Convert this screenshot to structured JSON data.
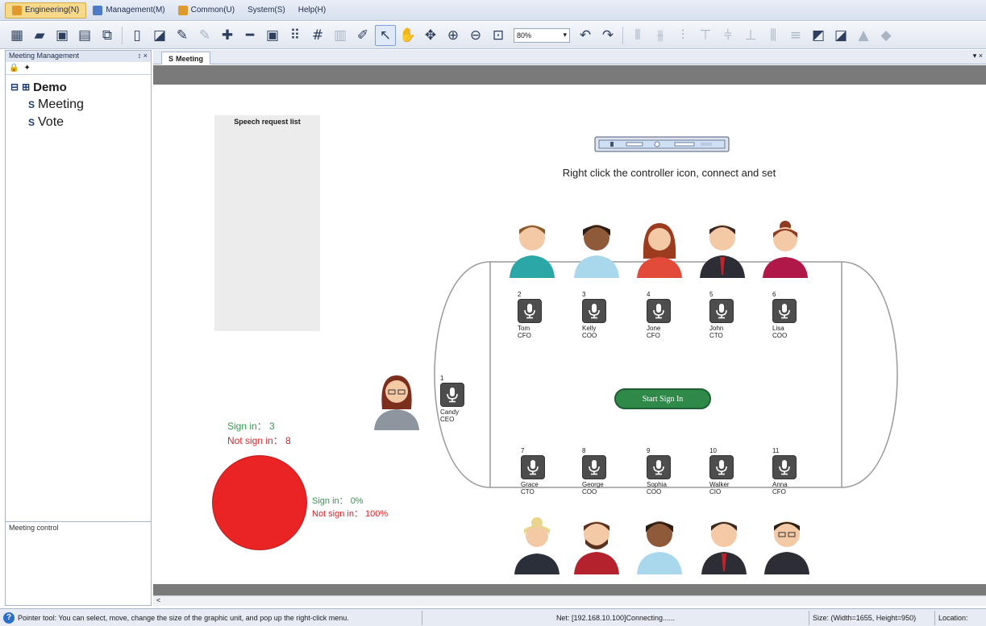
{
  "menu": {
    "items": [
      {
        "label": "Engineering(N)"
      },
      {
        "label": "Management(M)"
      },
      {
        "label": "Common(U)"
      },
      {
        "label": "System(S)"
      },
      {
        "label": "Help(H)"
      }
    ]
  },
  "toolbar": {
    "zoom_value": "80%",
    "zoom_arrow": "▾"
  },
  "left_panel": {
    "title": "Meeting Management",
    "pin": "↕ ×",
    "tree": {
      "root": "Demo",
      "children": [
        "Meeting",
        "Vote"
      ]
    },
    "meeting_control_title": "Meeting control"
  },
  "document": {
    "tab_label": "Meeting",
    "tab_menu": "▾ ×",
    "scroll_left": "<"
  },
  "canvas": {
    "speech_request_title": "Speech request list",
    "controller_hint": "Right click the controller icon, connect and set",
    "start_button": "Start Sign In",
    "seats": [
      {
        "num": "1",
        "name": "Candy",
        "role": "CEO"
      },
      {
        "num": "2",
        "name": "Tom",
        "role": "CFO"
      },
      {
        "num": "3",
        "name": "Kelly",
        "role": "COO"
      },
      {
        "num": "4",
        "name": "Jone",
        "role": "CFO"
      },
      {
        "num": "5",
        "name": "John",
        "role": "CTO"
      },
      {
        "num": "6",
        "name": "Lisa",
        "role": "COO"
      },
      {
        "num": "7",
        "name": "Grace",
        "role": "CTO"
      },
      {
        "num": "8",
        "name": "George",
        "role": "COO"
      },
      {
        "num": "9",
        "name": "Sophia",
        "role": "COO"
      },
      {
        "num": "10",
        "name": "Walker",
        "role": "CIO"
      },
      {
        "num": "11",
        "name": "Anna",
        "role": "CFO"
      }
    ],
    "sign_in_label": "Sign in：",
    "sign_in_count": "3",
    "not_sign_in_label": "Not sign in：",
    "not_sign_in_count": "8",
    "pie_sign_in": "Sign in： 0%",
    "pie_not_sign_in": "Not sign in： 100%"
  },
  "status": {
    "help": "Pointer tool: You can select, move, change the size of the graphic unit, and pop up the right-click menu.",
    "net": "Net: [192.168.10.100]Connecting......",
    "size": "Size: (Width=1655, Height=950)",
    "location": "Location:"
  },
  "colors": {
    "signed": "#2f9a4d",
    "not_signed": "#d9252a",
    "pie_fill": "#ea2424",
    "start_button": "#2f8a4a"
  }
}
